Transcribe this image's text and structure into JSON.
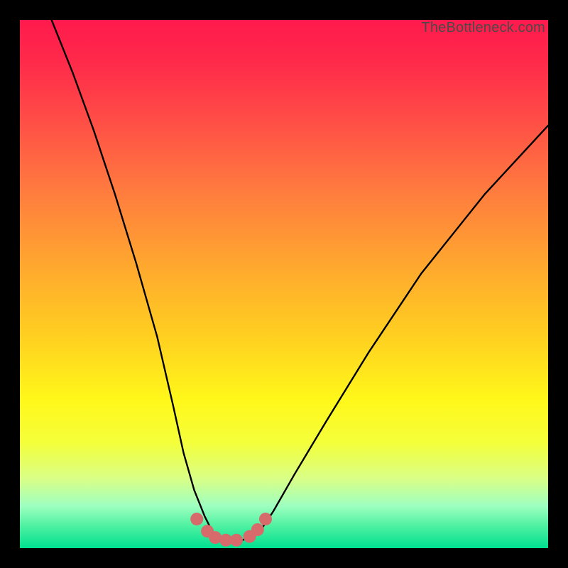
{
  "watermark": "TheBottleneck.com",
  "chart_data": {
    "type": "line",
    "title": "",
    "xlabel": "",
    "ylabel": "",
    "xlim": [
      0,
      100
    ],
    "ylim": [
      0,
      100
    ],
    "series": [
      {
        "name": "bottleneck-curve",
        "x": [
          6,
          10,
          14,
          18,
          22,
          26,
          29,
          31,
          33,
          35,
          36.5,
          38,
          40,
          42,
          44,
          46,
          48,
          52,
          58,
          66,
          76,
          88,
          100
        ],
        "y": [
          100,
          90,
          79,
          67,
          54,
          40,
          27,
          18,
          11,
          6,
          3,
          2,
          1.5,
          1.5,
          2,
          4,
          7,
          14,
          24,
          37,
          52,
          67,
          80
        ]
      },
      {
        "name": "bottom-markers",
        "x": [
          33.5,
          35.5,
          37,
          39,
          41,
          43.5,
          45,
          46.5
        ],
        "y": [
          5.5,
          3.2,
          2.0,
          1.5,
          1.5,
          2.2,
          3.5,
          5.5
        ]
      }
    ],
    "marker_color": "#d76a6a",
    "curve_color": "#000000"
  }
}
